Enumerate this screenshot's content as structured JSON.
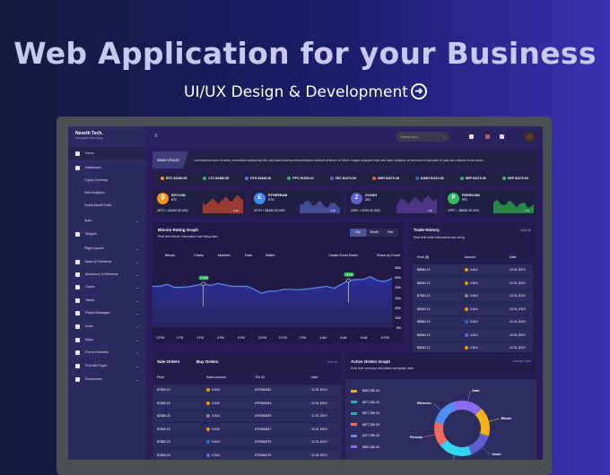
{
  "hero": {
    "title": "Web Application for your Business",
    "subtitle": "UI/UX Design & Development",
    "arrow_icon": "arrow-right-circle-icon"
  },
  "brand": {
    "name": "Nexeth Tech.",
    "tagline": "Information Technology"
  },
  "sidebar": {
    "items": [
      {
        "label": "Home",
        "active": true,
        "icon": true,
        "chev": false
      },
      {
        "label": "Dashboard",
        "icon": true,
        "chev": false
      },
      {
        "label": "Crypto Currency",
        "sub": true
      },
      {
        "label": "Web Analytics",
        "sub": true
      },
      {
        "label": "Social Media Trafic",
        "sub": true
      },
      {
        "label": "Apps",
        "sub": true,
        "chev": true
      },
      {
        "label": "Widgets",
        "icon": true
      },
      {
        "label": "Page Layouts",
        "sub": true,
        "chev": true
      },
      {
        "label": "Basic UI Elements",
        "icon": true,
        "chev": true
      },
      {
        "label": "Advanced UI Elements",
        "icon": true,
        "chev": true
      },
      {
        "label": "Charts",
        "icon": true,
        "chev": true
      },
      {
        "label": "Tables",
        "icon": true,
        "chev": true
      },
      {
        "label": "Popup Messages",
        "icon": true,
        "chev": true
      },
      {
        "label": "Icons",
        "icon": true,
        "chev": true
      },
      {
        "label": "Maps",
        "icon": true,
        "chev": true
      },
      {
        "label": "Forms Elements",
        "icon": true,
        "chev": true
      },
      {
        "label": "Prebuild Pages",
        "icon": true,
        "chev": true
      },
      {
        "label": "Ecommerce",
        "icon": true,
        "chev": true
      }
    ]
  },
  "topbar": {
    "search_placeholder": "Search here..."
  },
  "news": {
    "tag": "NEWS UPDATE",
    "text": "Lorem ipsum dolor sit amet, consetetur sadipscing elitr, sed diam nonumy eirmod tempor invidunt ut labore et dolore magna aliquyam erat, sed diam voluptua. At vero eos et accusam et justo duo dolores et ea rebum"
  },
  "ticker": [
    {
      "label": "BTC $1280.08",
      "color": "#f7931a"
    },
    {
      "label": "LTC $1380.08",
      "color": "#2ebd59"
    },
    {
      "label": "ETH $1330.08",
      "color": "#3d8bf2"
    },
    {
      "label": "PPC $1000.04",
      "color": "#2ebd59"
    },
    {
      "label": "ZEC $1270.09",
      "color": "#5b5fd0"
    },
    {
      "label": "XMR $1670.08",
      "color": "#f26822"
    },
    {
      "label": "DASH $1110.08",
      "color": "#1c75bc"
    },
    {
      "label": "XRP $1170.09",
      "color": "#2ebd59"
    },
    {
      "label": "XRP $1170.09",
      "color": "#2ebd59"
    }
  ],
  "cards": [
    {
      "name": "BITCOIN",
      "sym": "BTC",
      "value": "1BTC = $1250.00 USD",
      "pct": "9.9k",
      "color": "#f7931a",
      "letter": "₿",
      "spark": "#c0452c"
    },
    {
      "name": "ETHEREUM",
      "sym": "ETH",
      "value": "1ETH = $3460.00 USD",
      "pct": "9.9k",
      "color": "#3d8bf2",
      "letter": "E",
      "spark": "#4c5bb4"
    },
    {
      "name": "ZCASH",
      "sym": "ZEC",
      "value": "1ZEC = $750.00 USD",
      "pct": "7.9k",
      "color": "#5b5fd0",
      "letter": "Z",
      "spark": "#5a3f9a"
    },
    {
      "name": "PEERCOIN",
      "sym": "PPC",
      "value": "1PPC = $6000.00 USD",
      "pct": "7.9k",
      "color": "#2ebd59",
      "letter": "P",
      "spark": "#2ea84a"
    }
  ],
  "btc_chart": {
    "title": "Bitcoin Rating Graph",
    "subtitle": "Real time bitcoin information and rating data",
    "ranges": [
      "Day",
      "Month",
      "Year"
    ],
    "menu": [
      "Bitcoin",
      "Charts",
      "Markets",
      "Data",
      "Wallet",
      "Create Excel Sheet",
      "Share by Email"
    ],
    "y_ticks": [
      "650k",
      "550k",
      "450k",
      "350k",
      "250k",
      "150k",
      "50k"
    ],
    "x_ticks": [
      "12 PM",
      "2 PM",
      "4 PM",
      "6 PM",
      "8 PM",
      "10 PM",
      "12 PM",
      "2 PM",
      "4 AM",
      "6 AM",
      "8 AM",
      "10 PM"
    ],
    "ylim": [
      50,
      650
    ],
    "values": [
      470,
      470,
      490,
      460,
      462,
      465,
      480,
      495,
      480,
      500,
      485,
      470,
      470,
      470,
      440,
      400,
      420,
      420,
      440,
      440,
      435,
      440,
      450,
      460,
      470,
      450,
      490,
      530,
      540,
      540,
      570,
      530,
      520,
      550
    ],
    "markers": [
      {
        "index": 7,
        "label": "+ 1,400"
      },
      {
        "index": 27,
        "label": "+ 8,000"
      }
    ]
  },
  "trade": {
    "title": "Trade History",
    "subtitle": "Real time trade information and rating",
    "link": "View All",
    "headers": [
      "Price ($)",
      "Amount",
      "Date"
    ],
    "rows": [
      [
        "$8060.12",
        "0.614",
        "12.01.2019",
        "#f7931a"
      ],
      [
        "$8060.12",
        "0.614",
        "12.01.2019",
        "#f7931a"
      ],
      [
        "$7860.12",
        "0.614",
        "12.01.2019",
        "#888888"
      ],
      [
        "$8060.12",
        "0.614",
        "12.01.2019",
        "#f7931a"
      ],
      [
        "$8860.12",
        "0.614",
        "12.01.2019",
        "#1c75bc"
      ],
      [
        "$8060.12",
        "0.614",
        "12.01.2019",
        "#6c63e8"
      ],
      [
        "$8060.12",
        "0.614",
        "12.01.2019",
        "#f7931a"
      ]
    ]
  },
  "orders": {
    "tabs": [
      "Sale Orders",
      "Buy Orders"
    ],
    "link": "View All",
    "headers": [
      "Price",
      "Sales Amount",
      "TRL ID",
      "Date"
    ],
    "rows": [
      [
        "$7860.23",
        "0.543",
        "#TR346532",
        "12.01.2019",
        "#f7931a"
      ],
      [
        "$7860.23",
        "0.543",
        "#TR346534",
        "12.01.2019",
        "#f7931a"
      ],
      [
        "$2360.23",
        "0.543",
        "#TR346528",
        "12.01.2019",
        "#888888"
      ],
      [
        "$7860.23",
        "0.543",
        "#TR346527",
        "12.01.2019",
        "#f7931a"
      ],
      [
        "$7860.23",
        "0.543",
        "#TR346575",
        "12.01.2019",
        "#1c75bc"
      ],
      [
        "$7860.23",
        "0.543",
        "#TR346275",
        "12.01.2019",
        "#6c63e8"
      ]
    ]
  },
  "active": {
    "title": "Active Orders Graph",
    "subtitle": "Real time currency information and graph data",
    "link": "Manage Data",
    "legend": [
      {
        "value": "$957,280.00",
        "color": "#f5a623"
      },
      {
        "value": "$577,280.00",
        "color": "#1fb5a4"
      },
      {
        "value": "$677,280.00",
        "color": "#1fb5a4"
      },
      {
        "value": "$677,280.00",
        "color": "#f46a5c"
      },
      {
        "value": "$477,280.00",
        "color": "#4f8ef7"
      },
      {
        "value": "$587,280.00",
        "color": "#8b6cf0"
      }
    ],
    "slices": [
      {
        "label": "Dash",
        "value": 18,
        "color": "#8b6cf0"
      },
      {
        "label": "Bitcoin",
        "value": 17,
        "color": "#f5b21a"
      },
      {
        "label": "Zcash",
        "value": 15,
        "color": "#5b5fd0"
      },
      {
        "label": "Litecoin",
        "value": 20,
        "color": "#33d6ef"
      },
      {
        "label": "Peercoin",
        "value": 14,
        "color": "#f46a5c"
      },
      {
        "label": "Ethereum",
        "value": 16,
        "color": "#4f8ef7"
      }
    ]
  }
}
